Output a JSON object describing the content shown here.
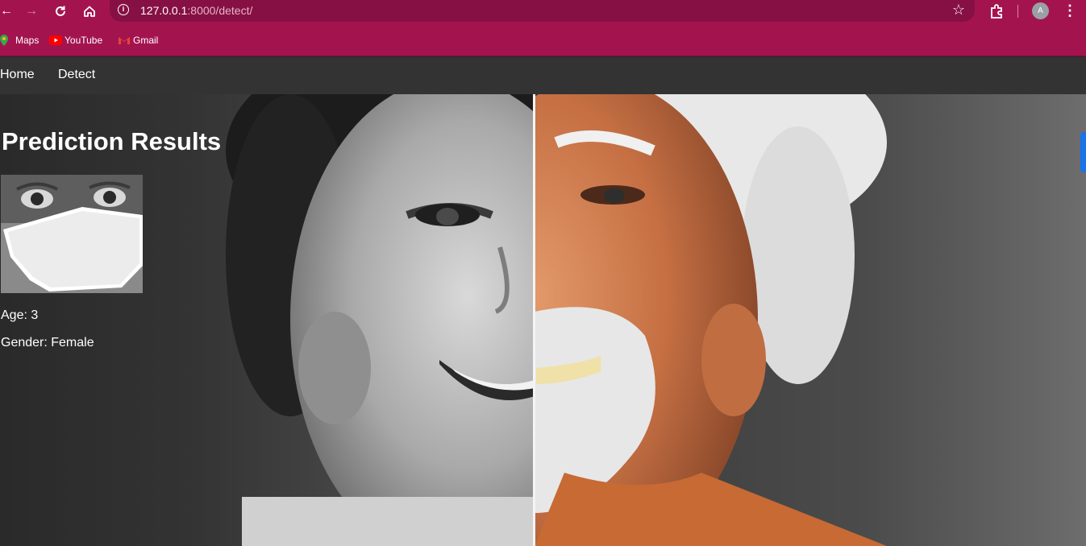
{
  "browser": {
    "url_host": "127.0.0.1",
    "url_path": ":8000/detect/",
    "avatar_letter": "A",
    "bookmarks": [
      {
        "label": "Maps",
        "icon": "maps-icon"
      },
      {
        "label": "YouTube",
        "icon": "youtube-icon"
      },
      {
        "label": "Gmail",
        "icon": "gmail-icon"
      }
    ],
    "theme_color": "#a3144f"
  },
  "nav": {
    "links": [
      "Home",
      "Detect"
    ]
  },
  "results": {
    "title": "Prediction Results",
    "age_line": "Age: 3",
    "gender_line": "Gender: Female"
  }
}
